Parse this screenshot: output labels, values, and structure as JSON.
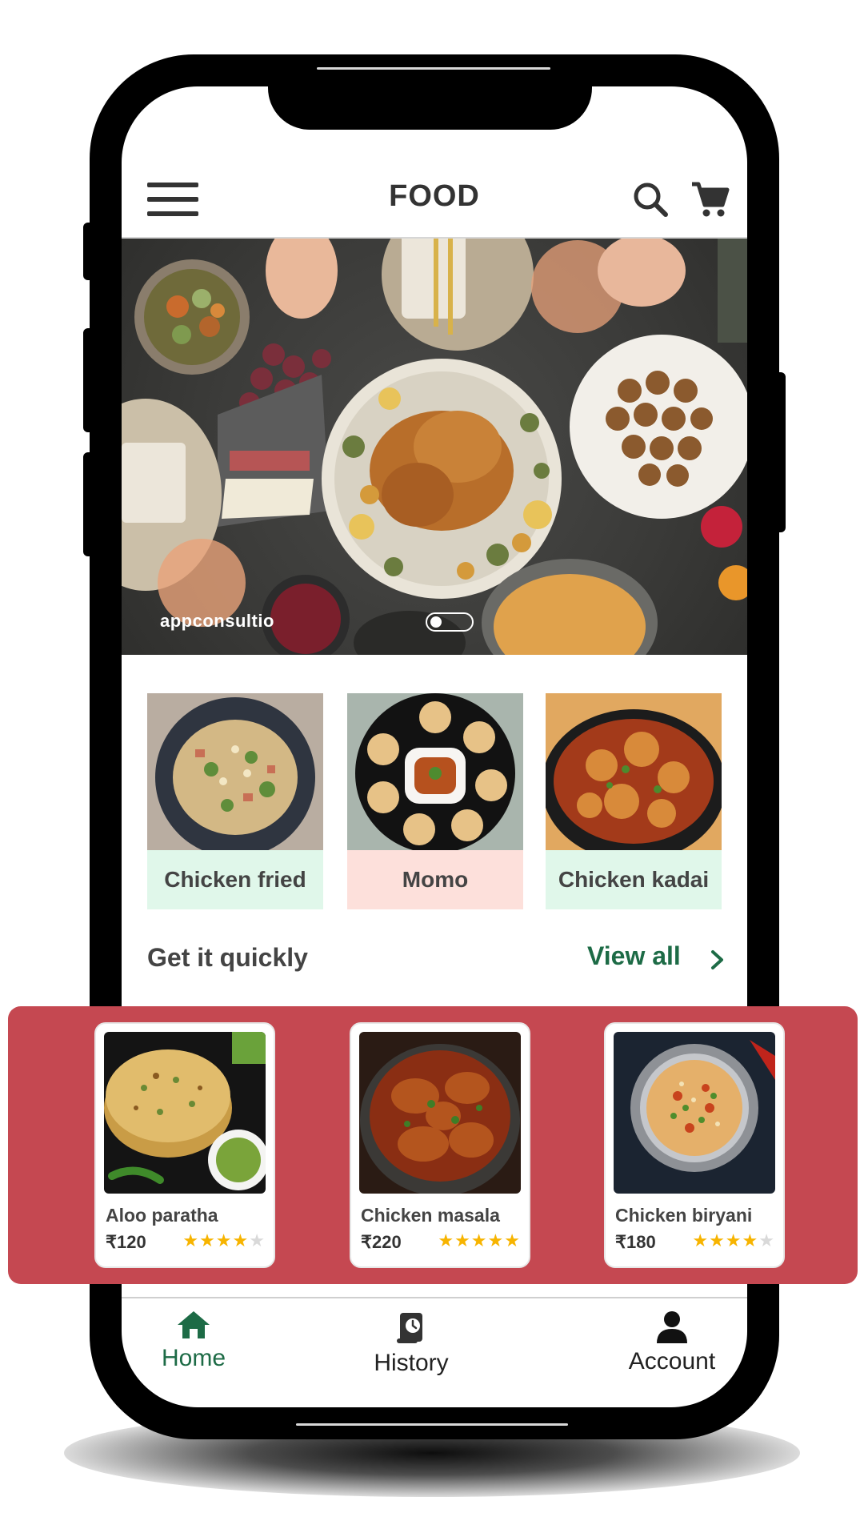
{
  "header": {
    "menu_icon": "hamburger-menu-icon",
    "title": "FOOD",
    "search_icon": "search-icon",
    "cart_icon": "cart-icon"
  },
  "hero": {
    "brand_text": "appconsultio",
    "carousel_position": 1,
    "carousel_count": 2
  },
  "categories": [
    {
      "label": "Chicken fried",
      "color": "#e0f7ea"
    },
    {
      "label": "Momo",
      "color": "#fde0db"
    },
    {
      "label": "Chicken kadai",
      "color": "#e0f7ea"
    }
  ],
  "section": {
    "title": "Get it quickly",
    "view_all": "View all"
  },
  "products": [
    {
      "name": "Aloo paratha",
      "price": "₹120",
      "rating": 4
    },
    {
      "name": "Chicken masala",
      "price": "₹220",
      "rating": 5
    },
    {
      "name": "Chicken biryani",
      "price": "₹180",
      "rating": 4
    }
  ],
  "nav": {
    "items": [
      {
        "label": "Home",
        "icon": "home-icon",
        "active": true
      },
      {
        "label": "History",
        "icon": "history-icon",
        "active": false
      },
      {
        "label": "Account",
        "icon": "account-icon",
        "active": false
      }
    ]
  },
  "colors": {
    "accent_green": "#1d6b46",
    "band_red": "#c54851",
    "star_gold": "#f7b400"
  }
}
